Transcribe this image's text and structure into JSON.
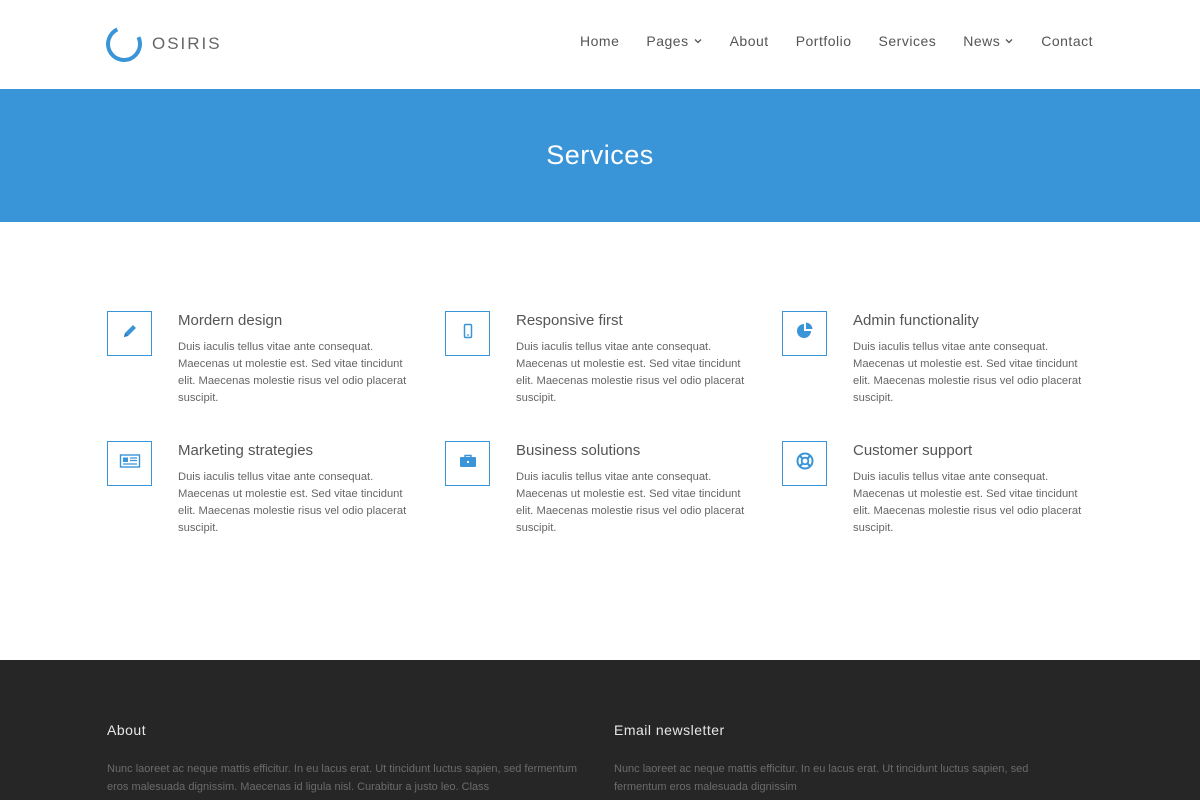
{
  "brand": {
    "name": "OSIRIS",
    "accent": "#3a95d8",
    "footer_bg": "#262626"
  },
  "nav": {
    "items": [
      {
        "label": "Home",
        "dropdown": false
      },
      {
        "label": "Pages",
        "dropdown": true
      },
      {
        "label": "About",
        "dropdown": false
      },
      {
        "label": "Portfolio",
        "dropdown": false
      },
      {
        "label": "Services",
        "dropdown": false
      },
      {
        "label": "News",
        "dropdown": true
      },
      {
        "label": "Contact",
        "dropdown": false
      }
    ]
  },
  "banner": {
    "title": "Services"
  },
  "services": [
    {
      "icon": "pencil-icon",
      "title": "Mordern design",
      "text": "Duis iaculis tellus vitae ante consequat. Maecenas ut molestie est. Sed vitae tincidunt elit. Maecenas molestie risus vel odio placerat suscipit."
    },
    {
      "icon": "mobile-phone-icon",
      "title": "Responsive first",
      "text": "Duis iaculis tellus vitae ante consequat. Maecenas ut molestie est. Sed vitae tincidunt elit. Maecenas molestie risus vel odio placerat suscipit."
    },
    {
      "icon": "pie-chart-icon",
      "title": "Admin functionality",
      "text": "Duis iaculis tellus vitae ante consequat. Maecenas ut molestie est. Sed vitae tincidunt elit. Maecenas molestie risus vel odio placerat suscipit."
    },
    {
      "icon": "newspaper-icon",
      "title": "Marketing strategies",
      "text": "Duis iaculis tellus vitae ante consequat. Maecenas ut molestie est. Sed vitae tincidunt elit. Maecenas molestie risus vel odio placerat suscipit."
    },
    {
      "icon": "briefcase-icon",
      "title": "Business solutions",
      "text": "Duis iaculis tellus vitae ante consequat. Maecenas ut molestie est. Sed vitae tincidunt elit. Maecenas molestie risus vel odio placerat suscipit."
    },
    {
      "icon": "life-ring-icon",
      "title": "Customer support",
      "text": "Duis iaculis tellus vitae ante consequat. Maecenas ut molestie est. Sed vitae tincidunt elit. Maecenas molestie risus vel odio placerat suscipit."
    }
  ],
  "footer": {
    "about": {
      "title": "About",
      "text": "Nunc laoreet ac neque mattis efficitur. In eu lacus erat. Ut tincidunt luctus sapien, sed fermentum eros malesuada dignissim. Maecenas id ligula nisl. Curabitur a justo leo. Class"
    },
    "newsletter": {
      "title": "Email newsletter",
      "text": "Nunc laoreet ac neque mattis efficitur. In eu lacus erat. Ut tincidunt luctus sapien, sed fermentum eros malesuada dignissim"
    }
  }
}
